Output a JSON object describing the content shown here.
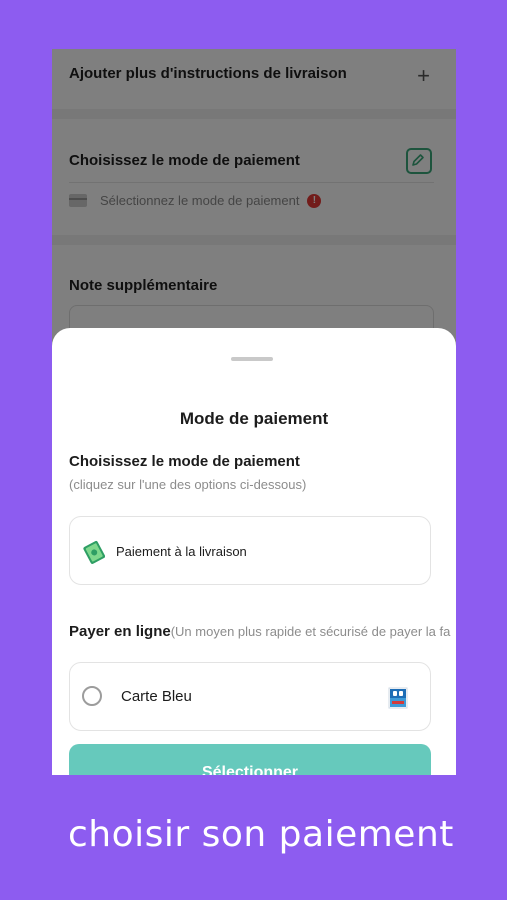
{
  "background": {
    "delivery_instructions": "Ajouter plus d'instructions de livraison",
    "plus_icon": "+",
    "payment_section_title": "Choisissez le mode de paiement",
    "payment_placeholder": "Sélectionnez le mode de paiement",
    "warning_icon": "!",
    "note_title": "Note supplémentaire"
  },
  "sheet": {
    "title": "Mode de paiement",
    "choose_title": "Choisissez le mode de paiement",
    "choose_subtitle": "(cliquez sur l'une des options ci-dessous)",
    "cash_option": "Paiement à la livraison",
    "online_title": "Payer en ligne",
    "online_subtitle": "(Un moyen plus rapide et sécurisé de payer la fa",
    "card_option": "Carte Bleu",
    "select_button": "Sélectionner"
  },
  "caption": "choisir son paiement",
  "colors": {
    "accent_green": "#3aa87a",
    "button_teal": "#66c9bc",
    "frame_purple": "#8d5cf0"
  }
}
